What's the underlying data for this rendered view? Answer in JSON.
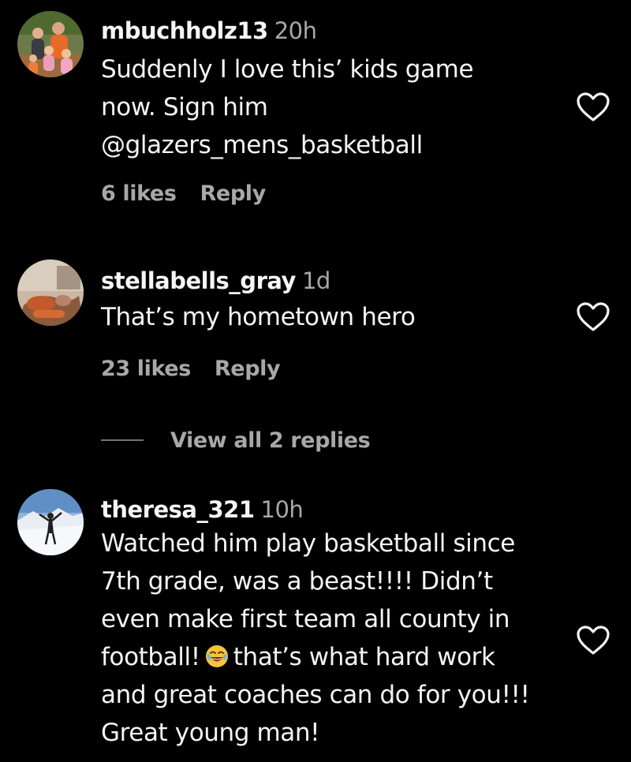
{
  "comments": [
    {
      "username": "mbuchholz13",
      "time": "20h",
      "lines": [
        "Suddenly I love this’ kids game",
        "now. Sign him",
        "@glazers_mens_basketball"
      ],
      "likes": "6 likes",
      "reply": "Reply",
      "avatar": "family-photo-avatar",
      "like_icon": "heart-outline-icon"
    },
    {
      "username": "stellabells_gray",
      "time": "1d",
      "lines": [
        "That’s my hometown hero"
      ],
      "likes": "23 likes",
      "reply": "Reply",
      "avatar": "photo-avatar",
      "like_icon": "heart-outline-icon",
      "view_replies": "View all 2 replies"
    },
    {
      "username": "theresa_321",
      "time": "10h",
      "lines": [
        "Watched him play basketball since",
        "7th grade, was a beast!!!! Didn’t",
        "even make first team all county in"
      ],
      "line4_before": "football!",
      "emoji": "😂",
      "line4_after": "that’s what hard work",
      "lines_end": [
        "and great coaches can do for you!!!",
        "Great young man!"
      ],
      "avatar": "snow-photo-avatar",
      "like_icon": "heart-outline-icon"
    }
  ],
  "colors": {
    "background": "#000000",
    "primary_text": "#f5f5f5",
    "secondary_text": "#a8a8a8"
  }
}
